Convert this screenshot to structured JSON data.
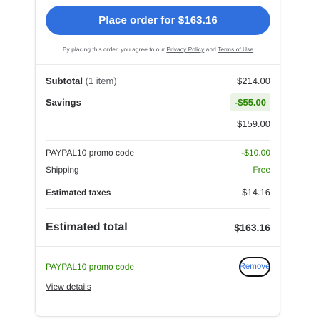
{
  "place_order": {
    "label": "Place order for $163.16"
  },
  "terms": {
    "prefix": "By placing this order, you agree to our",
    "privacy_link": "Privacy Policy",
    "and": "and",
    "terms_link": "Terms of Use"
  },
  "summary": {
    "subtotal_label": "Subtotal",
    "subtotal_items": "(1 item)",
    "subtotal_original": "$214.00",
    "savings_label": "Savings",
    "savings_value": "-$55.00",
    "subtotal_after": "$159.00",
    "promo_label": "PAYPAL10 promo code",
    "promo_value": "-$10.00",
    "shipping_label": "Shipping",
    "shipping_value": "Free",
    "taxes_label": "Estimated taxes",
    "taxes_value": "$14.16",
    "total_label": "Estimated total",
    "total_value": "$163.16"
  },
  "promo": {
    "code_label": "PAYPAL10 promo code",
    "remove_label": "Remove",
    "view_details": "View details"
  },
  "colors": {
    "primary": "#2f6fde",
    "savings_green": "#2a8703",
    "savings_bg": "#eaf3e6"
  }
}
